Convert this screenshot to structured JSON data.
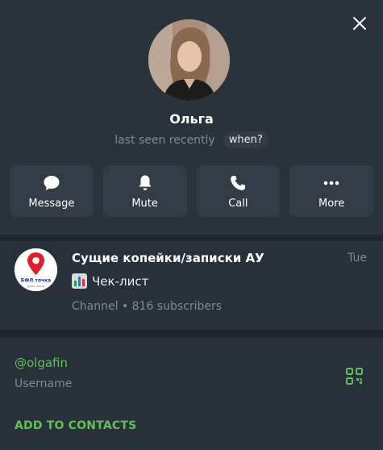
{
  "profile": {
    "name": "Ольга",
    "last_seen": "last seen recently",
    "when_label": "when?"
  },
  "actions": {
    "message": "Message",
    "mute": "Mute",
    "call": "Call",
    "more": "More"
  },
  "channel": {
    "title": "Сущие копейки/записки АУ",
    "time": "Tue",
    "message": "Чек-лист",
    "subtitle": "Channel • 816 subscribers",
    "logo_text": "БФЛ точка",
    "logo_subtext": "Дело связи"
  },
  "info": {
    "username": "@olgafin",
    "username_label": "Username",
    "add_to_contacts": "ADD TO CONTACTS"
  },
  "colors": {
    "accent_green": "#62c05a",
    "muted_text": "#7f8b98",
    "panel": "#28303a",
    "button_bg": "#323b46"
  }
}
